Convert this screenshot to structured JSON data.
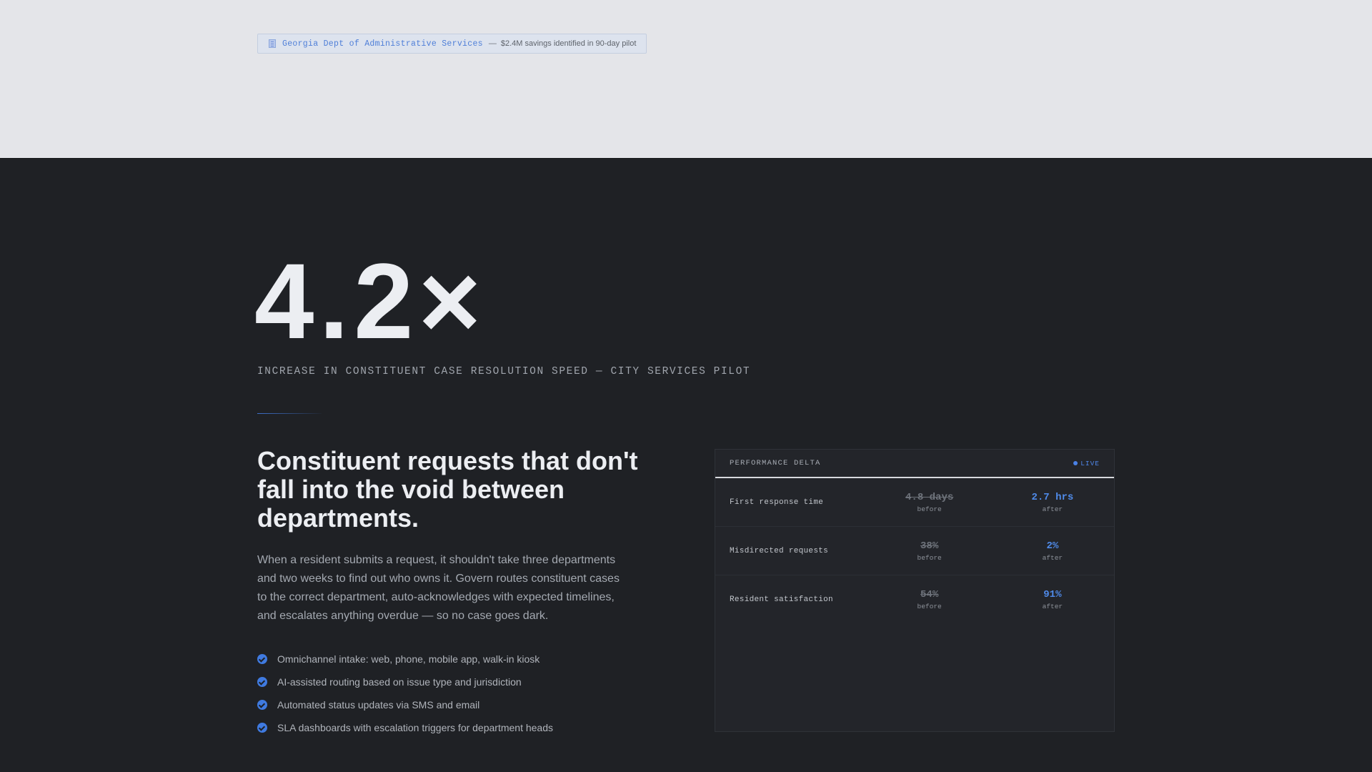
{
  "banner": {
    "org_name": "Georgia Dept of Administrative Services",
    "separator": "—",
    "detail": "$2.4M savings identified in 90-day pilot",
    "icon": "building-icon"
  },
  "hero": {
    "stat": "4.2×",
    "caption": "INCREASE IN CONSTITUENT CASE RESOLUTION SPEED — CITY SERVICES PILOT"
  },
  "content": {
    "headline": "Constituent requests that don't fall into the void between departments.",
    "body": "When a resident submits a request, it shouldn't take three departments and two weeks to find out who owns it. Govern routes constituent cases to the correct department, auto-acknowledges with expected timelines, and escalates anything overdue — so no case goes dark.",
    "features": [
      "Omnichannel intake: web, phone, mobile app, walk-in kiosk",
      "AI-assisted routing based on issue type and jurisdiction",
      "Automated status updates via SMS and email",
      "SLA dashboards with escalation triggers for department heads"
    ],
    "feature_icon": "check-circle-icon"
  },
  "panel": {
    "title": "PERFORMANCE DELTA",
    "live_label": "LIVE",
    "rows": [
      {
        "metric": "First response time",
        "before": "4.8 days",
        "before_label": "before",
        "after": "2.7 hrs",
        "after_label": "after"
      },
      {
        "metric": "Misdirected requests",
        "before": "38%",
        "before_label": "before",
        "after": "2%",
        "after_label": "after"
      },
      {
        "metric": "Resident satisfaction",
        "before": "54%",
        "before_label": "before",
        "after": "91%",
        "after_label": "after"
      }
    ]
  },
  "colors": {
    "accent": "#4f8ae8",
    "page_dark": "#1f2125",
    "page_light": "#e4e5e9"
  }
}
